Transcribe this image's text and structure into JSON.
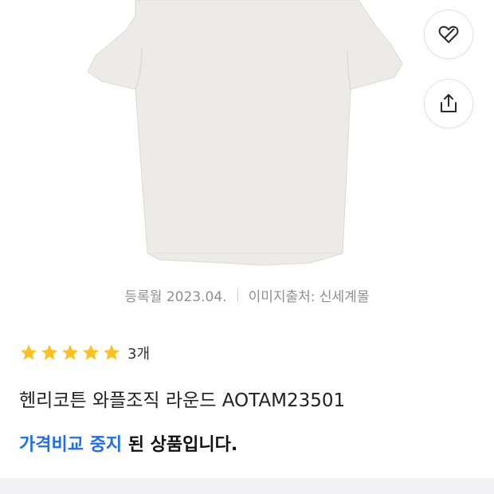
{
  "product_image": {
    "icon": "t-shirt-product-photo",
    "color": "#ecebe7"
  },
  "actions": {
    "wish_icon": "heart-outline-icon",
    "share_icon": "share-icon"
  },
  "meta": {
    "registered": "등록월 2023.04.",
    "image_source": "이미지출처: 신세계몰"
  },
  "rating": {
    "stars": 5,
    "max": 5,
    "review_count": "3개",
    "star_color": "#fcc21b"
  },
  "product": {
    "title": "헨리코튼 와플조직 라운드 AOTAM23501"
  },
  "notice": {
    "highlight": "가격비교 중지",
    "rest": " 된 상품입니다.",
    "highlight_color": "#1b6cff"
  }
}
